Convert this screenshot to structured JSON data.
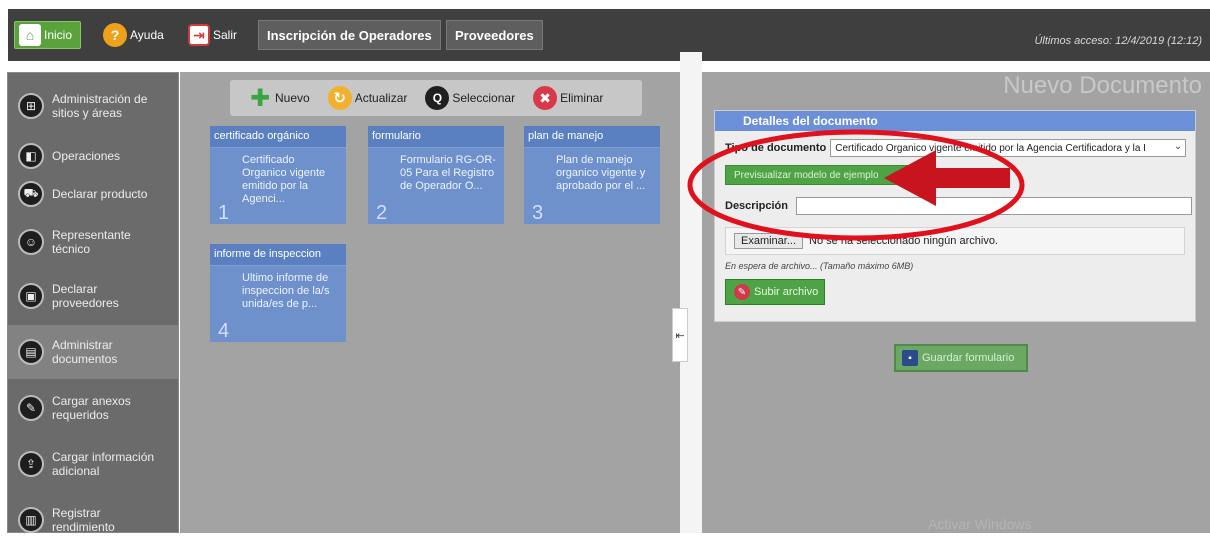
{
  "topbar": {
    "inicio_label": "Inicio",
    "ayuda_label": "Ayuda",
    "salir_label": "Salir",
    "tabs": [
      "Inscripción de Operadores",
      "Proveedores"
    ],
    "last_access": "Últimos acceso: 12/4/2019 (12:12)"
  },
  "sidebar": {
    "items": [
      {
        "label": "Administración de sitios y áreas",
        "icon": "map-icon"
      },
      {
        "label": "Operaciones",
        "icon": "operations-icon"
      },
      {
        "label": "Declarar producto",
        "icon": "cart-icon"
      },
      {
        "label": "Representante técnico",
        "icon": "people-icon"
      },
      {
        "label": "Declarar proveedores",
        "icon": "box-icon"
      },
      {
        "label": "Administrar documentos",
        "icon": "document-icon"
      },
      {
        "label": "Cargar anexos requeridos",
        "icon": "attachment-icon"
      },
      {
        "label": "Cargar información adicional",
        "icon": "upload-icon"
      },
      {
        "label": "Registrar rendimiento",
        "icon": "chart-icon"
      }
    ]
  },
  "toolbar": {
    "nuevo": "Nuevo",
    "actualizar": "Actualizar",
    "seleccionar": "Seleccionar",
    "eliminar": "Eliminar"
  },
  "documents": [
    {
      "header": "certificado orgánico",
      "text": "Certificado Organico vigente emitido por la Agenci...",
      "num": "1"
    },
    {
      "header": "formulario",
      "text": "Formulario RG-OR-05 Para el Registro de Operador O...",
      "num": "2"
    },
    {
      "header": "plan de manejo",
      "text": "Plan de manejo organico vigente y aprobado por el ...",
      "num": "3"
    },
    {
      "header": "informe de inspeccion",
      "text": "Ultimo informe de inspeccion de la/s unida/es de p...",
      "num": "4"
    }
  ],
  "right": {
    "title": "Nuevo Documento",
    "panel_header": "Detalles del documento",
    "tipo_label": "Tipo de documento",
    "tipo_value": "Certificado Organico vigente emitido por la Agencia Certificadora y la I",
    "previsualizar": "Previsualizar modelo de ejemplo",
    "descripcion_label": "Descripción",
    "examinar": "Examinar...",
    "no_file": "No se ha seleccionado ningún archivo.",
    "file_hint": "En espera de archivo... (Tamaño máximo 6MB)",
    "subir": "Subir archivo",
    "guardar": "Guardar formulario",
    "watermark": "Activar Windows"
  },
  "colors": {
    "accent_green": "#4ea345",
    "card_blue": "#6e90cb",
    "annotation_red": "#e0101c"
  }
}
